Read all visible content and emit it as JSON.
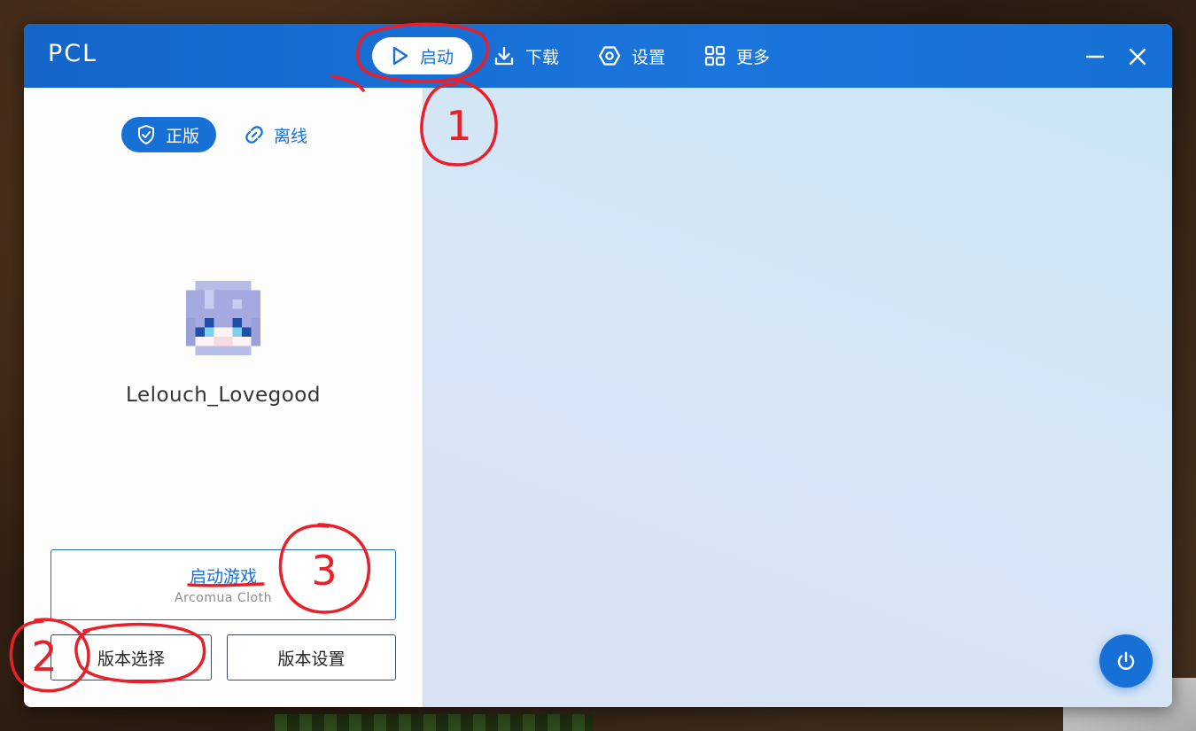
{
  "window": {
    "app_title": "PCL"
  },
  "nav": {
    "items": [
      {
        "label": "启动",
        "icon": "play-icon",
        "active": true
      },
      {
        "label": "下载",
        "icon": "download-icon",
        "active": false
      },
      {
        "label": "设置",
        "icon": "settings-icon",
        "active": false
      },
      {
        "label": "更多",
        "icon": "grid-icon",
        "active": false
      }
    ]
  },
  "account": {
    "tabs": [
      {
        "label": "正版",
        "icon": "shield-check-icon",
        "active": true
      },
      {
        "label": "离线",
        "icon": "link-icon",
        "active": false
      }
    ],
    "username": "Lelouch_Lovegood"
  },
  "launch": {
    "title": "启动游戏",
    "version": "Arcomua Cloth",
    "select_version_label": "版本选择",
    "version_settings_label": "版本设置"
  },
  "annotations": [
    "1",
    "2",
    "3"
  ],
  "colors": {
    "accent": "#1670d6",
    "annotation": "#e8202a"
  }
}
